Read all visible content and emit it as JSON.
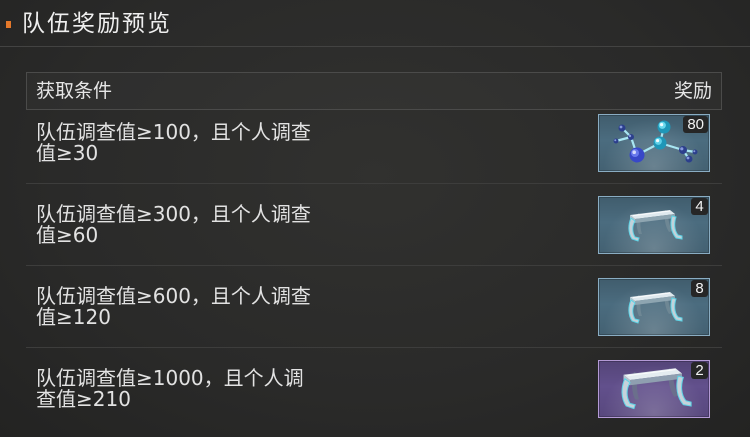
{
  "window": {
    "title": "队伍奖励预览"
  },
  "table": {
    "header": {
      "condition_label": "获取条件",
      "reward_label": "奖励"
    },
    "rows": [
      {
        "condition_lines": [
          "队伍调查值≥100，且个人调查",
          "值≥30"
        ],
        "reward": {
          "icon": "molecule-icon",
          "count": "80",
          "frame_color": "#8aadc3",
          "fill_color": "#4b6c7f"
        }
      },
      {
        "condition_lines": [
          "队伍调查值≥300，且个人调查",
          "值≥60"
        ],
        "reward": {
          "icon": "metal-bracket-icon",
          "count": "4",
          "frame_color": "#8aadc3",
          "fill_color": "#4b6c7f"
        }
      },
      {
        "condition_lines": [
          "队伍调查值≥600，且个人调查",
          "值≥120"
        ],
        "reward": {
          "icon": "metal-bracket-icon",
          "count": "8",
          "frame_color": "#8aadc3",
          "fill_color": "#4b6c7f"
        }
      },
      {
        "condition_lines": [
          "队伍调查值≥1000，且个人调",
          "查值≥210"
        ],
        "reward": {
          "icon": "metal-bracket-icon",
          "count": "2",
          "frame_color": "#b49ad6",
          "fill_color": "#62508c"
        }
      }
    ]
  },
  "colors": {
    "title_marker": "#e4782a",
    "background": "#2a2a29",
    "text": "#e2e2e2"
  }
}
